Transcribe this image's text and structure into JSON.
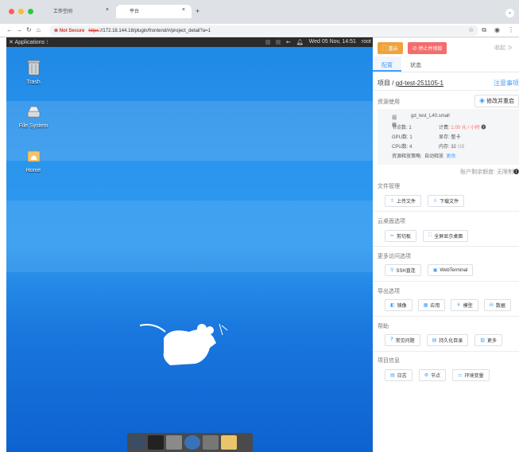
{
  "browser": {
    "tabs": [
      {
        "label": "工作空间"
      },
      {
        "label": "平台"
      }
    ],
    "url_warning": "Not Secure",
    "url_https": "https",
    "url_rest": "://172.18.144.18/plugin/frontend/#/project_detail?a=1"
  },
  "desktop": {
    "apps_label": "Applications",
    "clock": "Wed 05 Nov, 14:51",
    "user": "root",
    "icons": [
      {
        "label": "Trash"
      },
      {
        "label": "File System"
      },
      {
        "label": "Home"
      }
    ]
  },
  "panel": {
    "restart": "重启",
    "stop": "停止并销毁",
    "collapse": "收起 ≫",
    "tabs": [
      "配置",
      "状态"
    ],
    "project_prefix": "项目 / ",
    "project_name": "gd-test-251105-1",
    "notice": "注意事项",
    "resource_title": "资源使用",
    "modify_btn": "修改并重启",
    "spec_label": "规格:",
    "spec_value": "gd_test_L40.small",
    "nodes": "节点数:  1",
    "gpus": "GPU数:  1",
    "cpus": "CPU数:  4",
    "fee_label": "计费:",
    "fee_value": "1.00 元 / 小时",
    "vram_label": "显存:",
    "vram_value": "整卡",
    "mem_label": "内存:",
    "mem_value": "32",
    "mem_unit": "GB",
    "release_label": "资源释放策略:",
    "release_value": "自动释放",
    "release_change": "更改",
    "balance": "账户剩余额度: 无限制",
    "file_title": "文件管理",
    "upload": "上传文件",
    "download": "下载文件",
    "cloud_title": "云桌面选项",
    "clipboard": "剪切板",
    "fullscreen": "全屏显示桌面",
    "access_title": "更多访问选项",
    "ssh": "SSH直连",
    "webterminal": "WebTerminal",
    "export_title": "导出选项",
    "mirror": "镜像",
    "app": "应用",
    "model": "模型",
    "data": "数据",
    "help_title": "帮助",
    "faq": "常见问题",
    "persist": "持久化目录",
    "more": "更多",
    "info_title": "项目信息",
    "log": "日志",
    "node": "节点",
    "env": "环境变量"
  },
  "colors": {
    "accent": "#409eff",
    "warn": "#f0a23b",
    "danger": "#f56c6c"
  }
}
